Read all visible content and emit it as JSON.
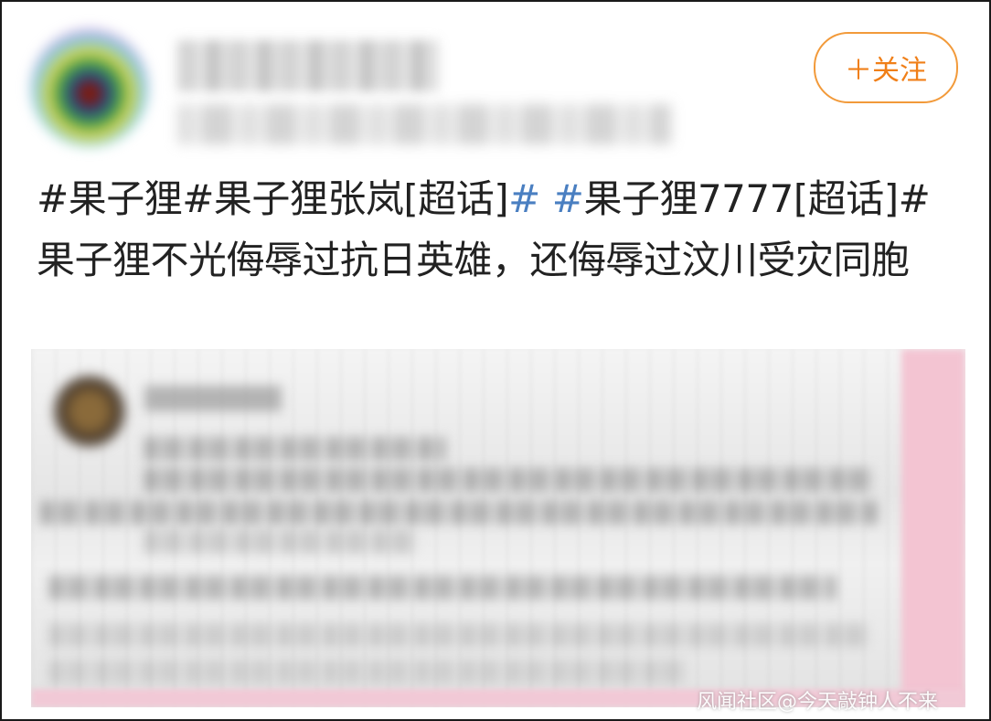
{
  "header": {
    "follow_label": "＋关注"
  },
  "post": {
    "topic_1": "#果子狸#",
    "topic_2": "果子狸张岚[超话]",
    "hash_a": "#",
    "hash_b": "#",
    "topic_3": "果子狸7777[超话]#",
    "body": " 果子狸不光侮辱过抗日英雄，还侮辱过汶川受灾同胞"
  },
  "watermark": "风闻社区@今天敲钟人不来",
  "colors": {
    "follow_accent": "#f07f18",
    "link_blue": "#4a7fc1"
  }
}
